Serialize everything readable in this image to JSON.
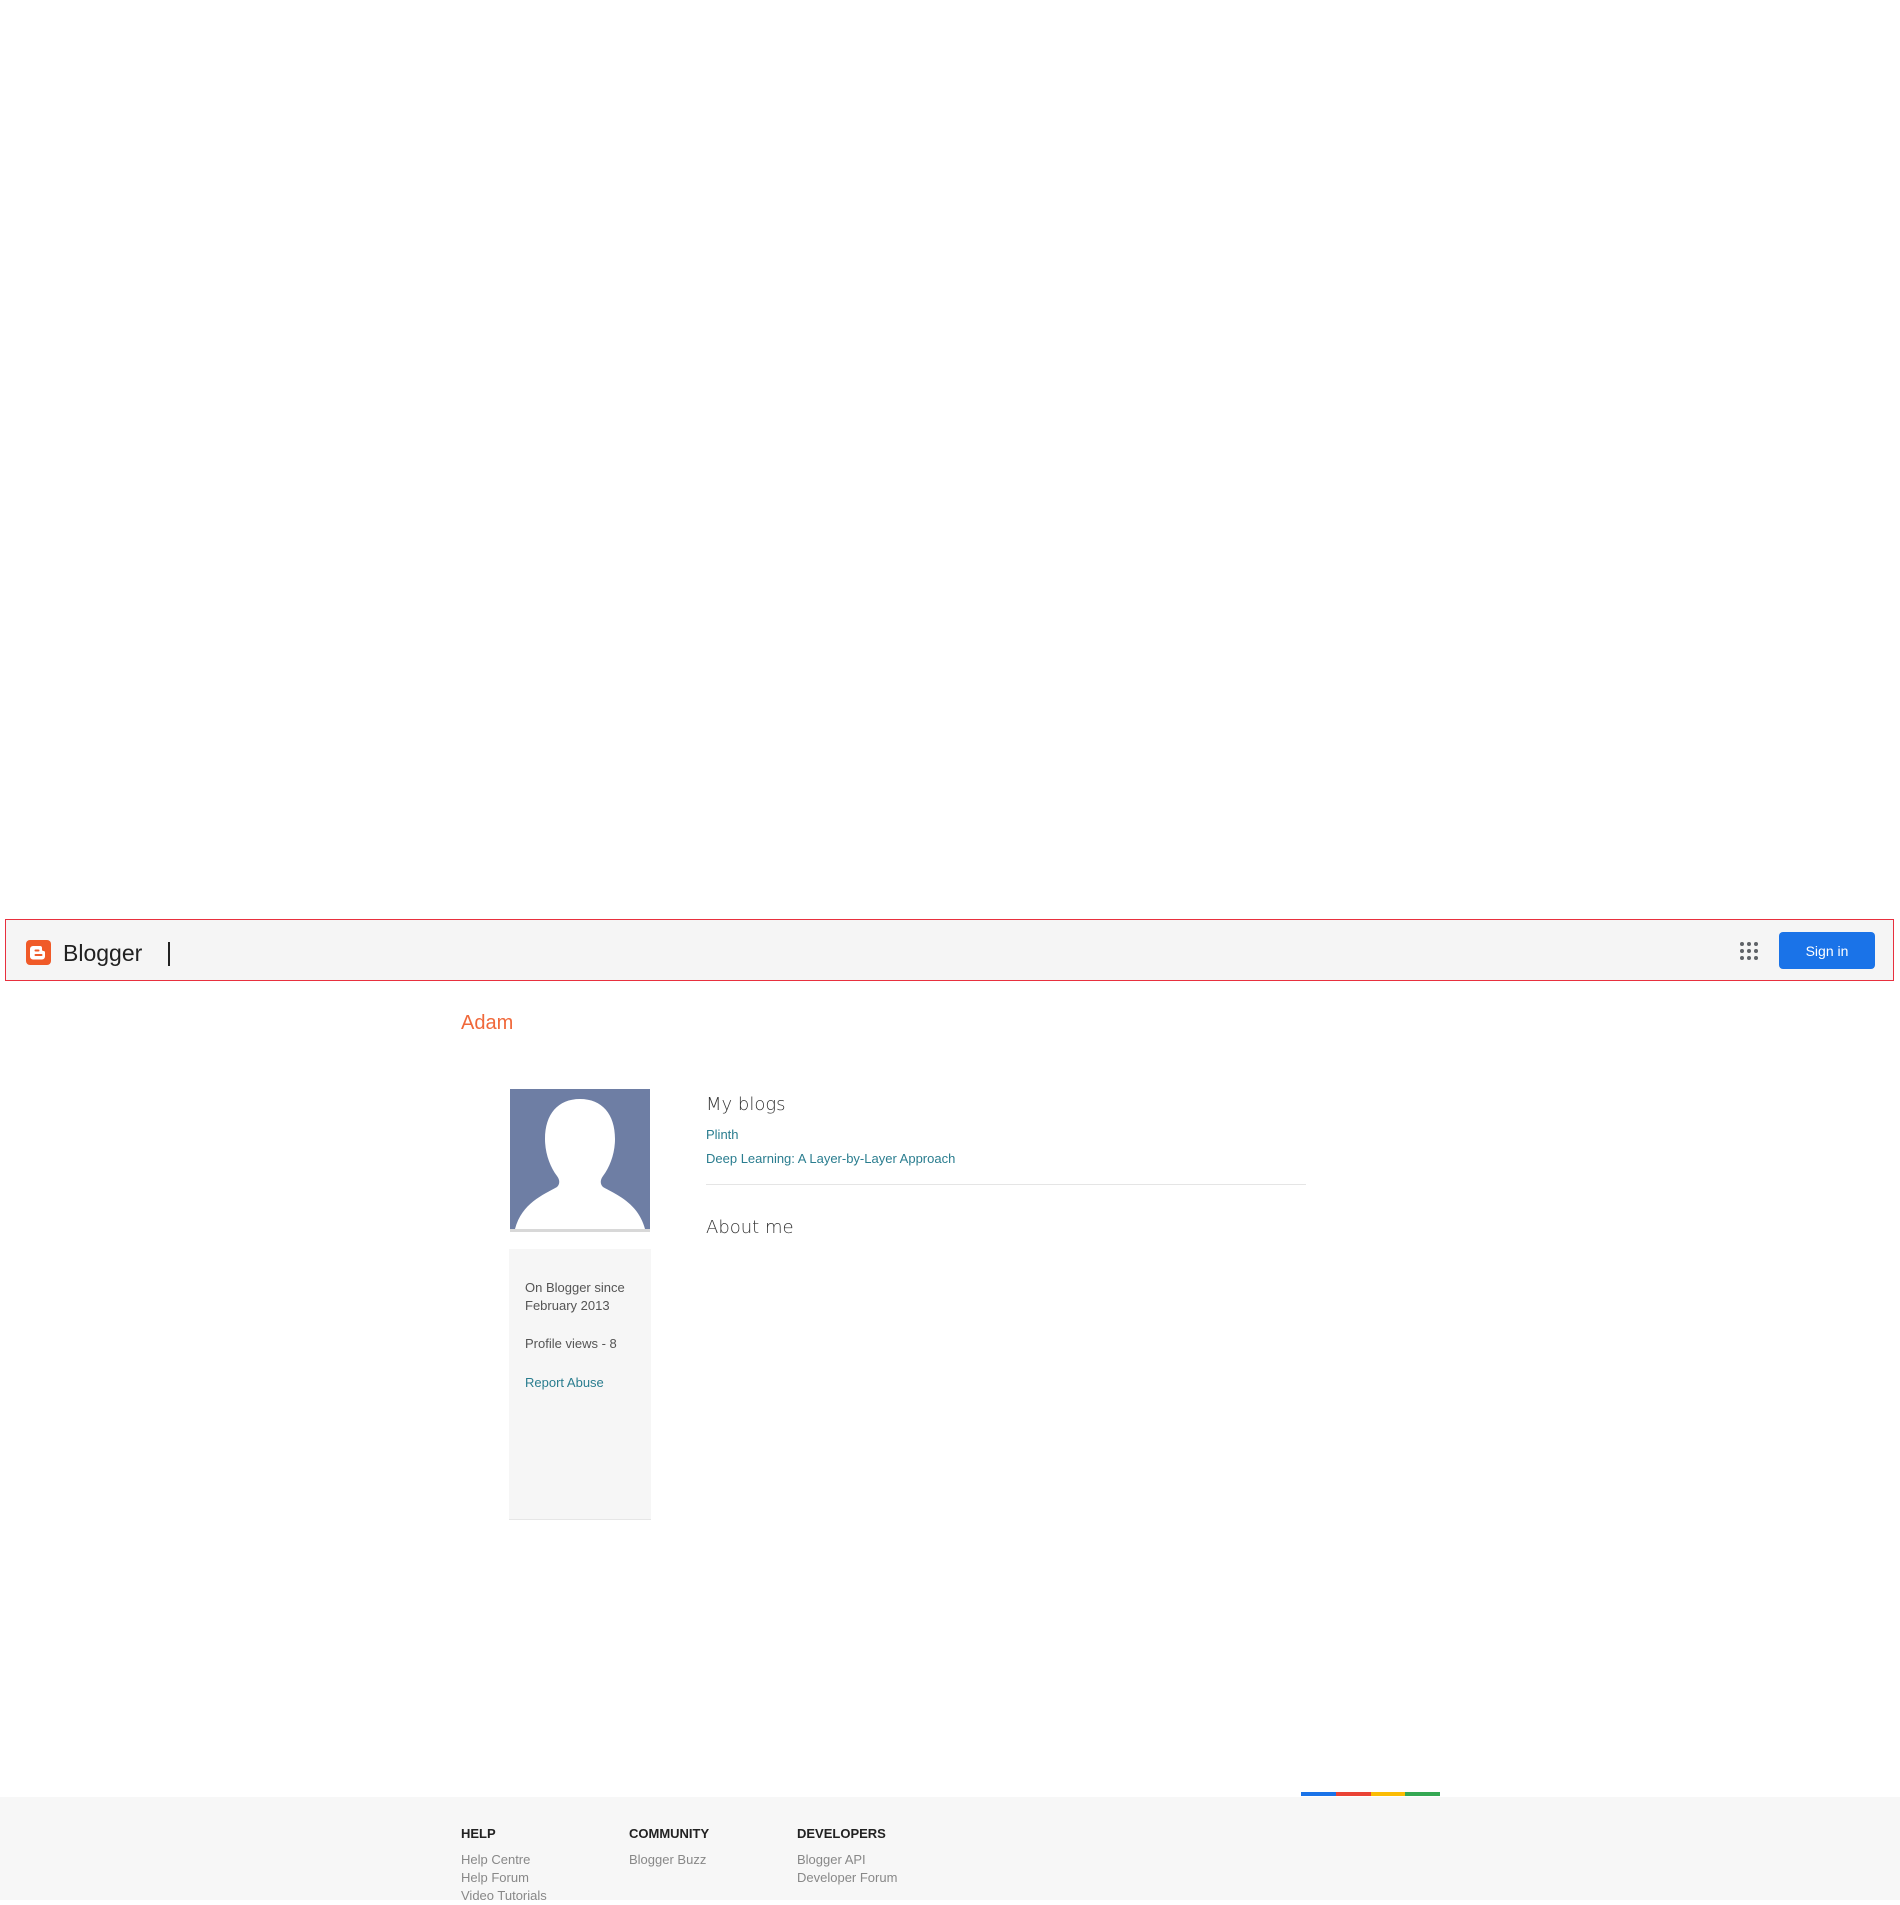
{
  "header": {
    "brand": "Blogger",
    "signin_label": "Sign in",
    "brand_color": "#f05a28",
    "signin_color": "#1a73e8"
  },
  "profile": {
    "name": "Adam",
    "since_line1": "On Blogger since",
    "since_line2": "February 2013",
    "views": "Profile views - 8",
    "report": "Report Abuse"
  },
  "main": {
    "my_blogs_title": "My blogs",
    "blogs": [
      "Plinth",
      "Deep Learning: A Layer-by-Layer Approach"
    ],
    "about_title": "About me"
  },
  "footer": {
    "columns": [
      {
        "heading": "HELP",
        "links": [
          "Help Centre",
          "Help Forum",
          "Video Tutorials"
        ]
      },
      {
        "heading": "COMMUNITY",
        "links": [
          "Blogger Buzz"
        ]
      },
      {
        "heading": "DEVELOPERS",
        "links": [
          "Blogger API",
          "Developer Forum"
        ]
      }
    ],
    "stripe_colors": [
      "#1a73e8",
      "#ea4335",
      "#fbbc04",
      "#34a853"
    ]
  }
}
